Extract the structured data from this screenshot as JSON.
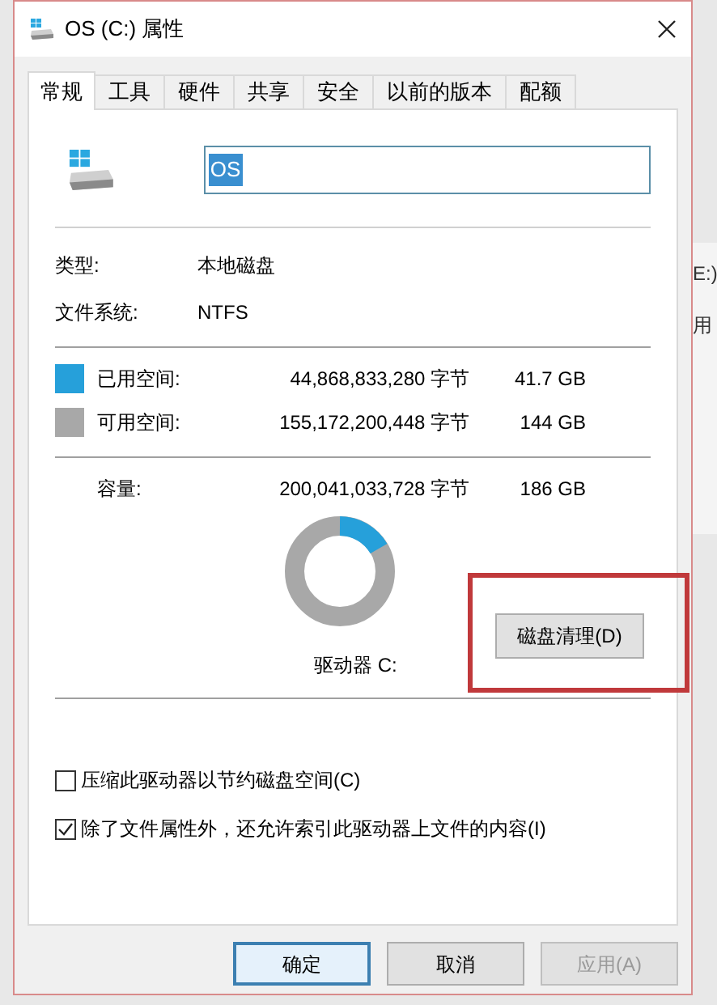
{
  "window": {
    "title": "OS (C:) 属性"
  },
  "background_window": {
    "texts": [
      "E:)",
      "用"
    ]
  },
  "tabs": [
    {
      "label": "常规",
      "selected": true
    },
    {
      "label": "工具",
      "selected": false
    },
    {
      "label": "硬件",
      "selected": false
    },
    {
      "label": "共享",
      "selected": false
    },
    {
      "label": "安全",
      "selected": false
    },
    {
      "label": "以前的版本",
      "selected": false
    },
    {
      "label": "配额",
      "selected": false
    }
  ],
  "name_field": {
    "value": "OS",
    "text_selected": true
  },
  "info": [
    {
      "label": "类型:",
      "value": "本地磁盘"
    },
    {
      "label": "文件系统:",
      "value": "NTFS"
    }
  ],
  "space": [
    {
      "label": "已用空间:",
      "bytes": "44,868,833,280 字节",
      "size": "41.7 GB",
      "color": "#26a0da"
    },
    {
      "label": "可用空间:",
      "bytes": "155,172,200,448 字节",
      "size": "144 GB",
      "color": "#a8a8a8"
    }
  ],
  "capacity": {
    "label": "容量:",
    "bytes": "200,041,033,728 字节",
    "size": "186 GB"
  },
  "drive_label": "驱动器 C:",
  "cleanup_button": {
    "label": "磁盘清理(D)",
    "highlighted": true
  },
  "options": [
    {
      "label": "压缩此驱动器以节约磁盘空间(C)",
      "checked": false
    },
    {
      "label": "除了文件属性外，还允许索引此驱动器上文件的内容(I)",
      "checked": true
    }
  ],
  "buttons": [
    {
      "label": "确定",
      "kind": "default",
      "disabled": false
    },
    {
      "label": "取消",
      "kind": "normal",
      "disabled": false
    },
    {
      "label": "应用(A)",
      "kind": "normal",
      "disabled": true
    }
  ]
}
